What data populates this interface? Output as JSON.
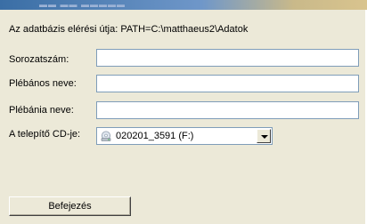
{
  "path_info": "Az adatbázis elérési útja: PATH=C:\\matthaeus2\\Adatok",
  "fields": {
    "serial_label": "Sorozatszám:",
    "serial_value": "",
    "priest_label": "Plébános neve:",
    "priest_value": "",
    "parish_label": "Plébánia neve:",
    "parish_value": ""
  },
  "installer_cd": {
    "label": "A telepítő CD-je:",
    "selected": "020201_3591 (F:)",
    "icon": "cd-drive-icon"
  },
  "finish_button": "Befejezés",
  "colors": {
    "panel": "#ece9d8",
    "input_border": "#7f9db9",
    "title_gradient_start": "#3a6ea5",
    "title_gradient_end": "#d9c48e"
  }
}
